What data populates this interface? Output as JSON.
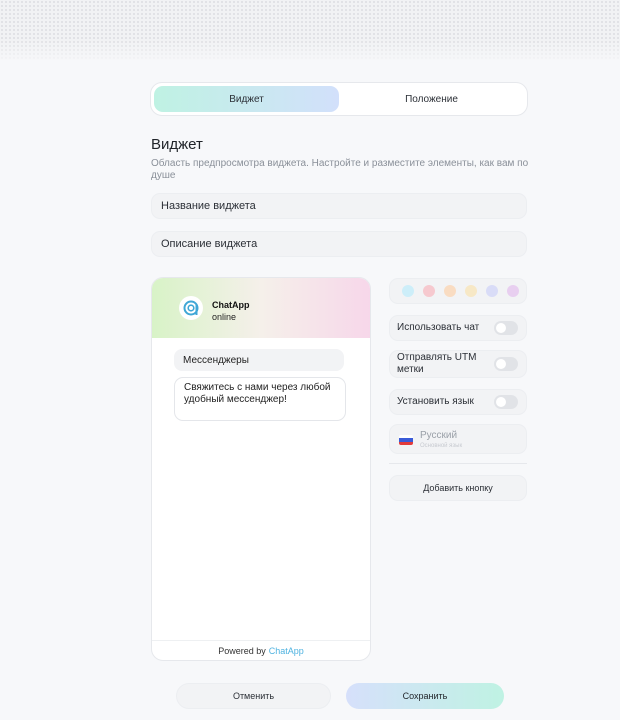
{
  "tabs": {
    "widget": "Виджет",
    "position": "Положение"
  },
  "section": {
    "title": "Виджет",
    "description": "Область предпросмотра виджета. Настройте и разместите элементы, как вам по душе"
  },
  "fields": {
    "name": "Название виджета",
    "description": "Описание виджета"
  },
  "preview": {
    "app_name": "ChatApp",
    "status": "online",
    "chip": "Мессенджеры",
    "message": "Свяжитесь с нами через любой удобный мессенджер!",
    "powered_by": "Powered by",
    "brand": "ChatApp"
  },
  "colors": [
    "#cdeef9",
    "#f6c9cf",
    "#f9dcc2",
    "#f7e8c6",
    "#d9dcf7",
    "#e8cff0",
    "#c6c9f3"
  ],
  "settings": {
    "use_chat": "Использовать чат",
    "send_utm": "Отправлять UTM метки",
    "set_language": "Установить язык",
    "language": "Русский",
    "language_sub": "Основной язык"
  },
  "buttons": {
    "add": "Добавить кнопку",
    "cancel": "Отменить",
    "save": "Сохранить"
  }
}
